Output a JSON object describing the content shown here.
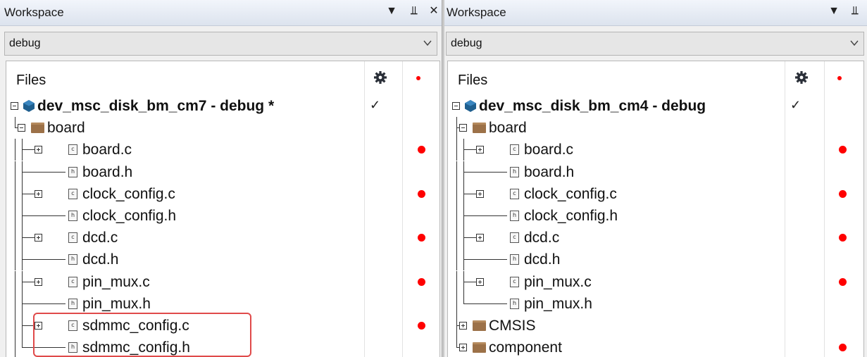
{
  "colors": {
    "highlight": "#e04a4a",
    "status_dot": "#ff0000",
    "folder": "#9c7148",
    "project": "#1f5f8f"
  },
  "panels": [
    {
      "title": "Workspace",
      "buttons": {
        "menu": "▼",
        "pin": "⫫",
        "close": "✕"
      },
      "config": "debug",
      "files_header": "Files",
      "header_icons": [
        "gear-icon",
        "red-dot"
      ],
      "rows": [
        {
          "label": "dev_msc_disk_bm_cm7 - debug *",
          "type": "project",
          "level": 0,
          "expander": "minus",
          "check": "✓",
          "dot": false
        },
        {
          "label": "board",
          "type": "folder",
          "level": 1,
          "expander": "minus",
          "check": "",
          "dot": false
        },
        {
          "label": "board.c",
          "type": "c",
          "level": 2,
          "expander": "plus",
          "check": "",
          "dot": true
        },
        {
          "label": "board.h",
          "type": "h",
          "level": 2,
          "expander": "none",
          "check": "",
          "dot": false
        },
        {
          "label": "clock_config.c",
          "type": "c",
          "level": 2,
          "expander": "plus",
          "check": "",
          "dot": true
        },
        {
          "label": "clock_config.h",
          "type": "h",
          "level": 2,
          "expander": "none",
          "check": "",
          "dot": false
        },
        {
          "label": "dcd.c",
          "type": "c",
          "level": 2,
          "expander": "plus",
          "check": "",
          "dot": true
        },
        {
          "label": "dcd.h",
          "type": "h",
          "level": 2,
          "expander": "none",
          "check": "",
          "dot": false
        },
        {
          "label": "pin_mux.c",
          "type": "c",
          "level": 2,
          "expander": "plus",
          "check": "",
          "dot": true
        },
        {
          "label": "pin_mux.h",
          "type": "h",
          "level": 2,
          "expander": "none",
          "check": "",
          "dot": false
        },
        {
          "label": "sdmmc_config.c",
          "type": "c",
          "level": 2,
          "expander": "plus",
          "check": "",
          "dot": true
        },
        {
          "label": "sdmmc_config.h",
          "type": "h",
          "level": 2,
          "expander": "none",
          "check": "",
          "dot": false
        }
      ]
    },
    {
      "title": "Workspace",
      "buttons": {
        "menu": "▼",
        "pin": "⫫",
        "close": ""
      },
      "config": "debug",
      "files_header": "Files",
      "header_icons": [
        "gear-icon",
        "red-dot"
      ],
      "rows": [
        {
          "label": "dev_msc_disk_bm_cm4 - debug",
          "type": "project",
          "level": 0,
          "expander": "minus",
          "check": "✓",
          "dot": false
        },
        {
          "label": "board",
          "type": "folder",
          "level": 1,
          "expander": "minus",
          "check": "",
          "dot": false
        },
        {
          "label": "board.c",
          "type": "c",
          "level": 2,
          "expander": "plus",
          "check": "",
          "dot": true
        },
        {
          "label": "board.h",
          "type": "h",
          "level": 2,
          "expander": "none",
          "check": "",
          "dot": false
        },
        {
          "label": "clock_config.c",
          "type": "c",
          "level": 2,
          "expander": "plus",
          "check": "",
          "dot": true
        },
        {
          "label": "clock_config.h",
          "type": "h",
          "level": 2,
          "expander": "none",
          "check": "",
          "dot": false
        },
        {
          "label": "dcd.c",
          "type": "c",
          "level": 2,
          "expander": "plus",
          "check": "",
          "dot": true
        },
        {
          "label": "dcd.h",
          "type": "h",
          "level": 2,
          "expander": "none",
          "check": "",
          "dot": false
        },
        {
          "label": "pin_mux.c",
          "type": "c",
          "level": 2,
          "expander": "plus",
          "check": "",
          "dot": true
        },
        {
          "label": "pin_mux.h",
          "type": "h",
          "level": 2,
          "expander": "none",
          "check": "",
          "dot": false
        },
        {
          "label": "CMSIS",
          "type": "folder",
          "level": 1,
          "expander": "plus",
          "check": "",
          "dot": false
        },
        {
          "label": "component",
          "type": "folder",
          "level": 1,
          "expander": "plus",
          "check": "",
          "dot": true
        }
      ]
    }
  ]
}
